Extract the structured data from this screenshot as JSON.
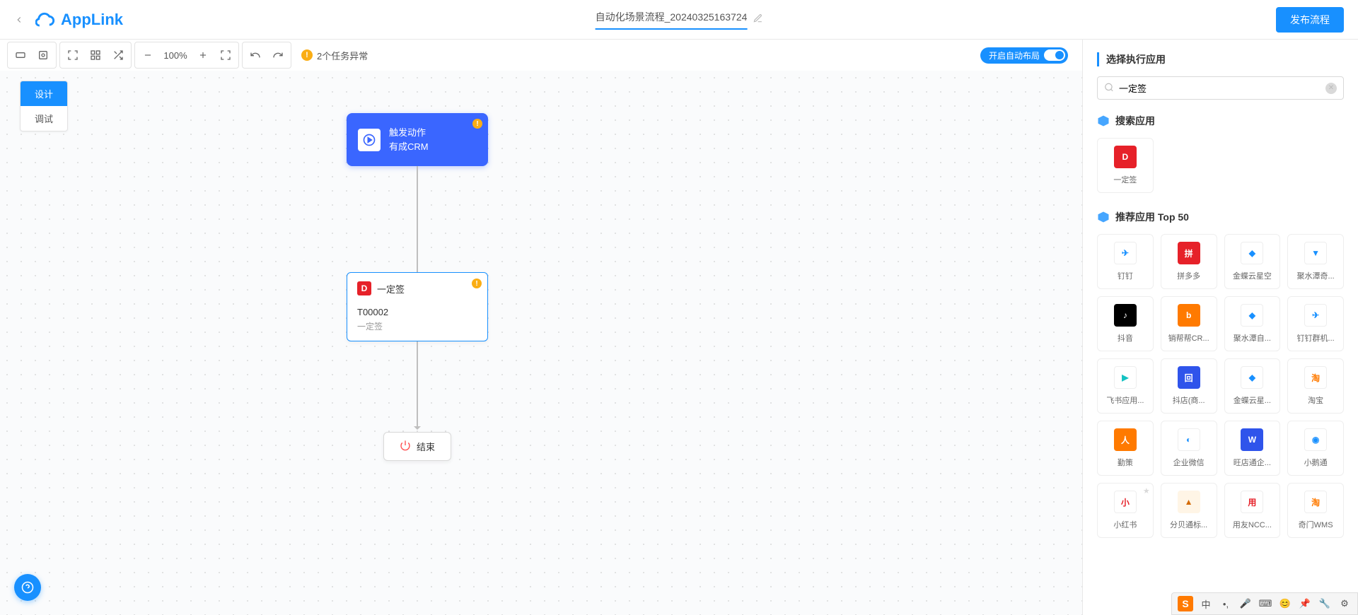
{
  "header": {
    "logo_text": "AppLink",
    "title": "自动化场景流程_20240325163724",
    "publish_button": "发布流程"
  },
  "toolbar": {
    "zoom": "100%",
    "warning_text": "2个任务异常",
    "auto_layout": "开启自动布局"
  },
  "mode_tabs": {
    "design": "设计",
    "debug": "调试"
  },
  "flow": {
    "trigger": {
      "line1": "触发动作",
      "line2": "有成CRM"
    },
    "task": {
      "title": "一定签",
      "id": "T00002",
      "sub": "一定签"
    },
    "end": "结束"
  },
  "panel": {
    "title": "选择执行应用",
    "search_value": "一定签",
    "section_search": "搜索应用",
    "section_top": "推荐应用 Top 50",
    "search_result": [
      {
        "label": "一定签",
        "icon": "D",
        "cls": "ic-red"
      }
    ],
    "top_apps": [
      {
        "label": "钉钉",
        "icon": "✈",
        "cls": "ic-white",
        "color": "#1890ff"
      },
      {
        "label": "拼多多",
        "icon": "拼",
        "cls": "ic-red"
      },
      {
        "label": "金蝶云星空",
        "icon": "◆",
        "cls": "ic-white",
        "color": "#1890ff"
      },
      {
        "label": "聚水潭奇...",
        "icon": "▼",
        "cls": "ic-white",
        "color": "#1890ff"
      },
      {
        "label": "抖音",
        "icon": "♪",
        "cls": "ic-black"
      },
      {
        "label": "销帮帮CR...",
        "icon": "b",
        "cls": "ic-orange"
      },
      {
        "label": "聚水潭自...",
        "icon": "◆",
        "cls": "ic-white",
        "color": "#1890ff"
      },
      {
        "label": "钉钉群机...",
        "icon": "✈",
        "cls": "ic-white",
        "color": "#1890ff"
      },
      {
        "label": "飞书应用...",
        "icon": "▶",
        "cls": "ic-white",
        "color": "#13c2c2"
      },
      {
        "label": "抖店(商...",
        "icon": "回",
        "cls": "ic-dblue"
      },
      {
        "label": "金蝶云星...",
        "icon": "◆",
        "cls": "ic-white",
        "color": "#1890ff"
      },
      {
        "label": "淘宝",
        "icon": "淘",
        "cls": "ic-white",
        "color": "#ff7a00"
      },
      {
        "label": "勤策",
        "icon": "人",
        "cls": "ic-orange"
      },
      {
        "label": "企业微信",
        "icon": "◐",
        "cls": "ic-white",
        "color": "#1890ff"
      },
      {
        "label": "旺店通企...",
        "icon": "W",
        "cls": "ic-dblue"
      },
      {
        "label": "小鹅通",
        "icon": "◉",
        "cls": "ic-white",
        "color": "#1890ff"
      },
      {
        "label": "小红书",
        "icon": "小",
        "cls": "ic-white",
        "color": "#e62129",
        "star": true
      },
      {
        "label": "分贝通标...",
        "icon": "▲",
        "cls": "ic-cream"
      },
      {
        "label": "用友NCC...",
        "icon": "用",
        "cls": "ic-white",
        "color": "#e62129"
      },
      {
        "label": "奇门WMS",
        "icon": "淘",
        "cls": "ic-white",
        "color": "#ff7a00"
      }
    ]
  },
  "ime": {
    "logo": "S",
    "lang": "中"
  }
}
